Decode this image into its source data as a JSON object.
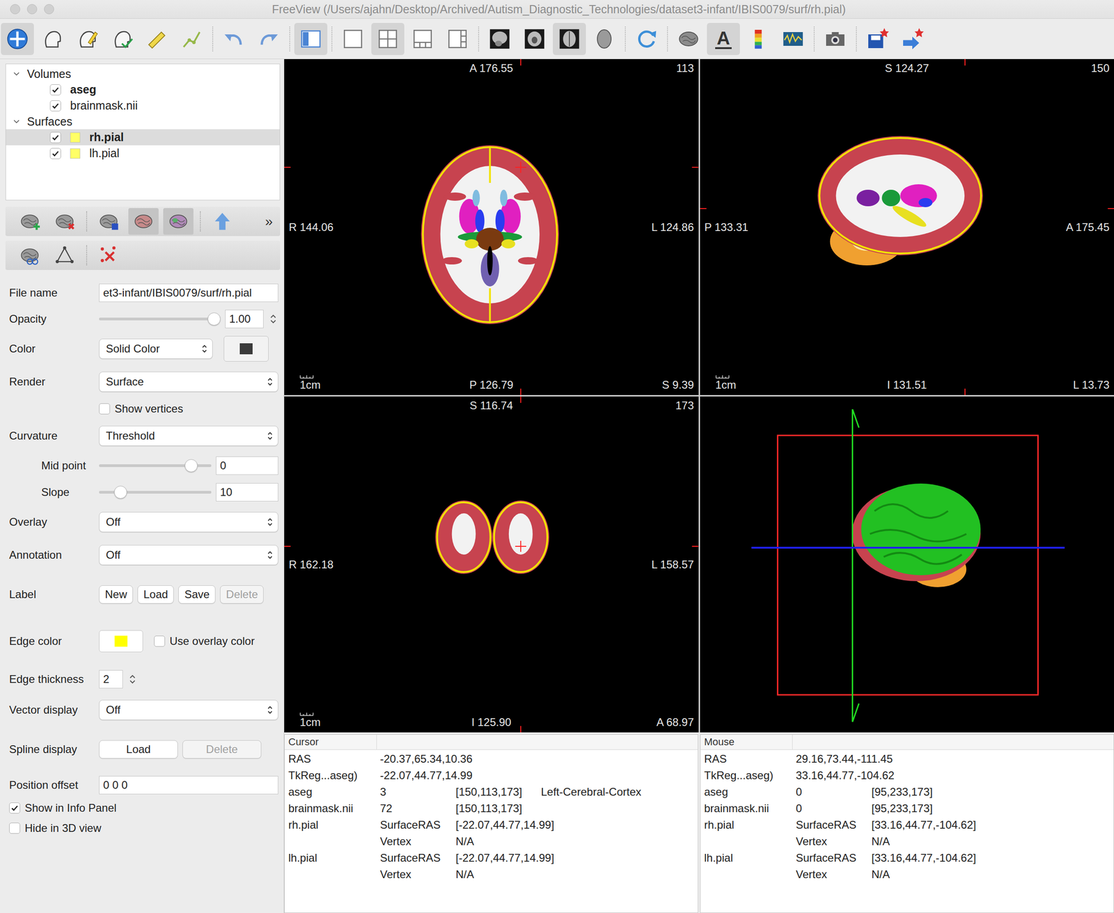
{
  "window": {
    "title": "FreeView (/Users/ajahn/Desktop/Archived/Autism_Diagnostic_Technologies/dataset3-infant/IBIS0079/surf/rh.pial)"
  },
  "toolbar": [
    [
      {
        "selected": true
      },
      {
        "selected": false
      },
      {
        "selected": false
      },
      {
        "selected": false
      },
      {
        "selected": false
      },
      {
        "selected": false
      }
    ],
    [
      {
        "selected": false
      },
      {
        "selected": false
      }
    ],
    [
      {
        "selected": true
      }
    ],
    [
      {
        "selected": false
      },
      {
        "selected": true
      },
      {
        "selected": false
      },
      {
        "selected": false
      }
    ],
    [
      {
        "selected": false
      },
      {
        "selected": false
      },
      {
        "selected": true
      },
      {
        "selected": false
      }
    ],
    [
      {
        "selected": false
      }
    ],
    [
      {
        "selected": false
      },
      {
        "text": "A",
        "selected": true
      },
      {
        "selected": false
      },
      {
        "selected": false
      }
    ],
    [
      {
        "selected": false
      }
    ],
    [
      {
        "selected": false
      },
      {
        "selected": false
      }
    ]
  ],
  "layers": [
    {
      "group": "Volumes",
      "expanded": true,
      "items": [
        {
          "name": "aseg",
          "checked": true,
          "active": true,
          "selected": false,
          "color": ""
        },
        {
          "name": "brainmask.nii",
          "checked": true,
          "active": false,
          "selected": false,
          "color": ""
        }
      ]
    },
    {
      "group": "Surfaces",
      "expanded": true,
      "items": [
        {
          "name": "rh.pial",
          "checked": true,
          "active": true,
          "selected": true,
          "color": "#ffff66"
        },
        {
          "name": "lh.pial",
          "checked": true,
          "active": false,
          "selected": false,
          "color": "#ffff66"
        }
      ]
    }
  ],
  "layer_tools": {
    "rows": [
      [
        [
          {
            "selected": false
          },
          {
            "selected": false
          }
        ],
        [
          {
            "selected": false
          },
          {
            "selected": true
          },
          {
            "selected": true
          }
        ],
        [
          {
            "selected": false
          }
        ]
      ],
      [
        [
          {
            "selected": false
          },
          {
            "selected": false
          }
        ],
        [
          {
            "selected": false
          }
        ]
      ]
    ],
    "more": "»"
  },
  "properties": [
    {
      "kind": "text",
      "label": "File name",
      "value": "et3-infant/IBIS0079/surf/rh.pial"
    },
    {
      "kind": "slider-spin",
      "label": "Opacity",
      "level": 1,
      "value": "1.00"
    },
    {
      "kind": "select-color",
      "label": "Color",
      "value": "Solid Color",
      "color": "#3a3a3a"
    },
    {
      "kind": "select",
      "label": "Render",
      "value": "Surface"
    },
    {
      "kind": "field-checkbox",
      "label": "Show vertices",
      "checked": false
    },
    {
      "kind": "select",
      "label": "Curvature",
      "value": "Threshold"
    },
    {
      "kind": "subslider",
      "label": "Mid point",
      "level": 0.86,
      "value": "0"
    },
    {
      "kind": "subslider",
      "label": "Slope",
      "level": 0.15,
      "value": "10"
    },
    {
      "kind": "select",
      "label": "Overlay",
      "value": "Off"
    },
    {
      "kind": "select",
      "label": "Annotation",
      "value": "Off"
    },
    {
      "kind": "buttons",
      "label": "Label",
      "buttons": [
        {
          "label": "New",
          "disabled": false
        },
        {
          "label": "Load",
          "disabled": false
        },
        {
          "label": "Save",
          "disabled": false
        },
        {
          "label": "Delete",
          "disabled": true
        }
      ]
    },
    {
      "kind": "color",
      "label": "Edge color",
      "color": "#ffff00",
      "checkbox": {
        "label": "Use overlay color",
        "checked": false
      }
    },
    {
      "kind": "spin",
      "label": "Edge thickness",
      "value": "2"
    },
    {
      "kind": "select",
      "label": "Vector display",
      "value": "Off"
    },
    {
      "kind": "buttons",
      "label": "Spline display",
      "buttons": [
        {
          "label": "Load",
          "disabled": false
        },
        {
          "label": "Delete",
          "disabled": true
        }
      ]
    },
    {
      "kind": "text",
      "label": "Position offset",
      "value": "0 0 0"
    },
    {
      "kind": "checkbox",
      "label": "Show in Info Panel",
      "checked": true
    },
    {
      "kind": "checkbox",
      "label": "Hide in 3D view",
      "checked": false
    }
  ],
  "views": [
    {
      "kind": "axial",
      "top": "A 176.55",
      "slice": "113",
      "left": "R 144.06",
      "right": "L 124.86",
      "bottom": "P 126.79",
      "corner": "S 9.39",
      "scale": "1cm"
    },
    {
      "kind": "sagittal",
      "top": "S 124.27",
      "slice": "150",
      "left": "P 133.31",
      "right": "A 175.45",
      "bottom": "I 131.51",
      "corner": "L 13.73",
      "scale": "1cm"
    },
    {
      "kind": "coronal",
      "top": "S 116.74",
      "slice": "173",
      "left": "R 162.18",
      "right": "L 158.57",
      "bottom": "I 125.90",
      "corner": "A 68.97",
      "scale": "1cm"
    },
    {
      "kind": "3d"
    }
  ],
  "info_panels": [
    {
      "title": "Cursor",
      "rows": [
        [
          "RAS",
          "-20.37,65.34,10.36"
        ],
        [
          "TkReg...aseg)",
          "-22.07,44.77,14.99"
        ],
        [
          "aseg",
          "3",
          "[150,113,173]",
          "Left-Cerebral-Cortex"
        ],
        [
          "brainmask.nii",
          "72",
          "[150,113,173]"
        ],
        [
          "rh.pial",
          "SurfaceRAS",
          "[-22.07,44.77,14.99]"
        ],
        [
          "",
          "Vertex",
          "N/A"
        ],
        [
          "lh.pial",
          "SurfaceRAS",
          "[-22.07,44.77,14.99]"
        ],
        [
          "",
          "Vertex",
          "N/A"
        ]
      ]
    },
    {
      "title": "Mouse",
      "rows": [
        [
          "RAS",
          "29.16,73.44,-111.45"
        ],
        [
          "TkReg...aseg)",
          "33.16,44.77,-104.62"
        ],
        [
          "aseg",
          "0",
          "[95,233,173]"
        ],
        [
          "brainmask.nii",
          "0",
          "[95,233,173]"
        ],
        [
          "rh.pial",
          "SurfaceRAS",
          "[33.16,44.77,-104.62]"
        ],
        [
          "",
          "Vertex",
          "N/A"
        ],
        [
          "lh.pial",
          "SurfaceRAS",
          "[33.16,44.77,-104.62]"
        ],
        [
          "",
          "Vertex",
          "N/A"
        ]
      ]
    }
  ]
}
